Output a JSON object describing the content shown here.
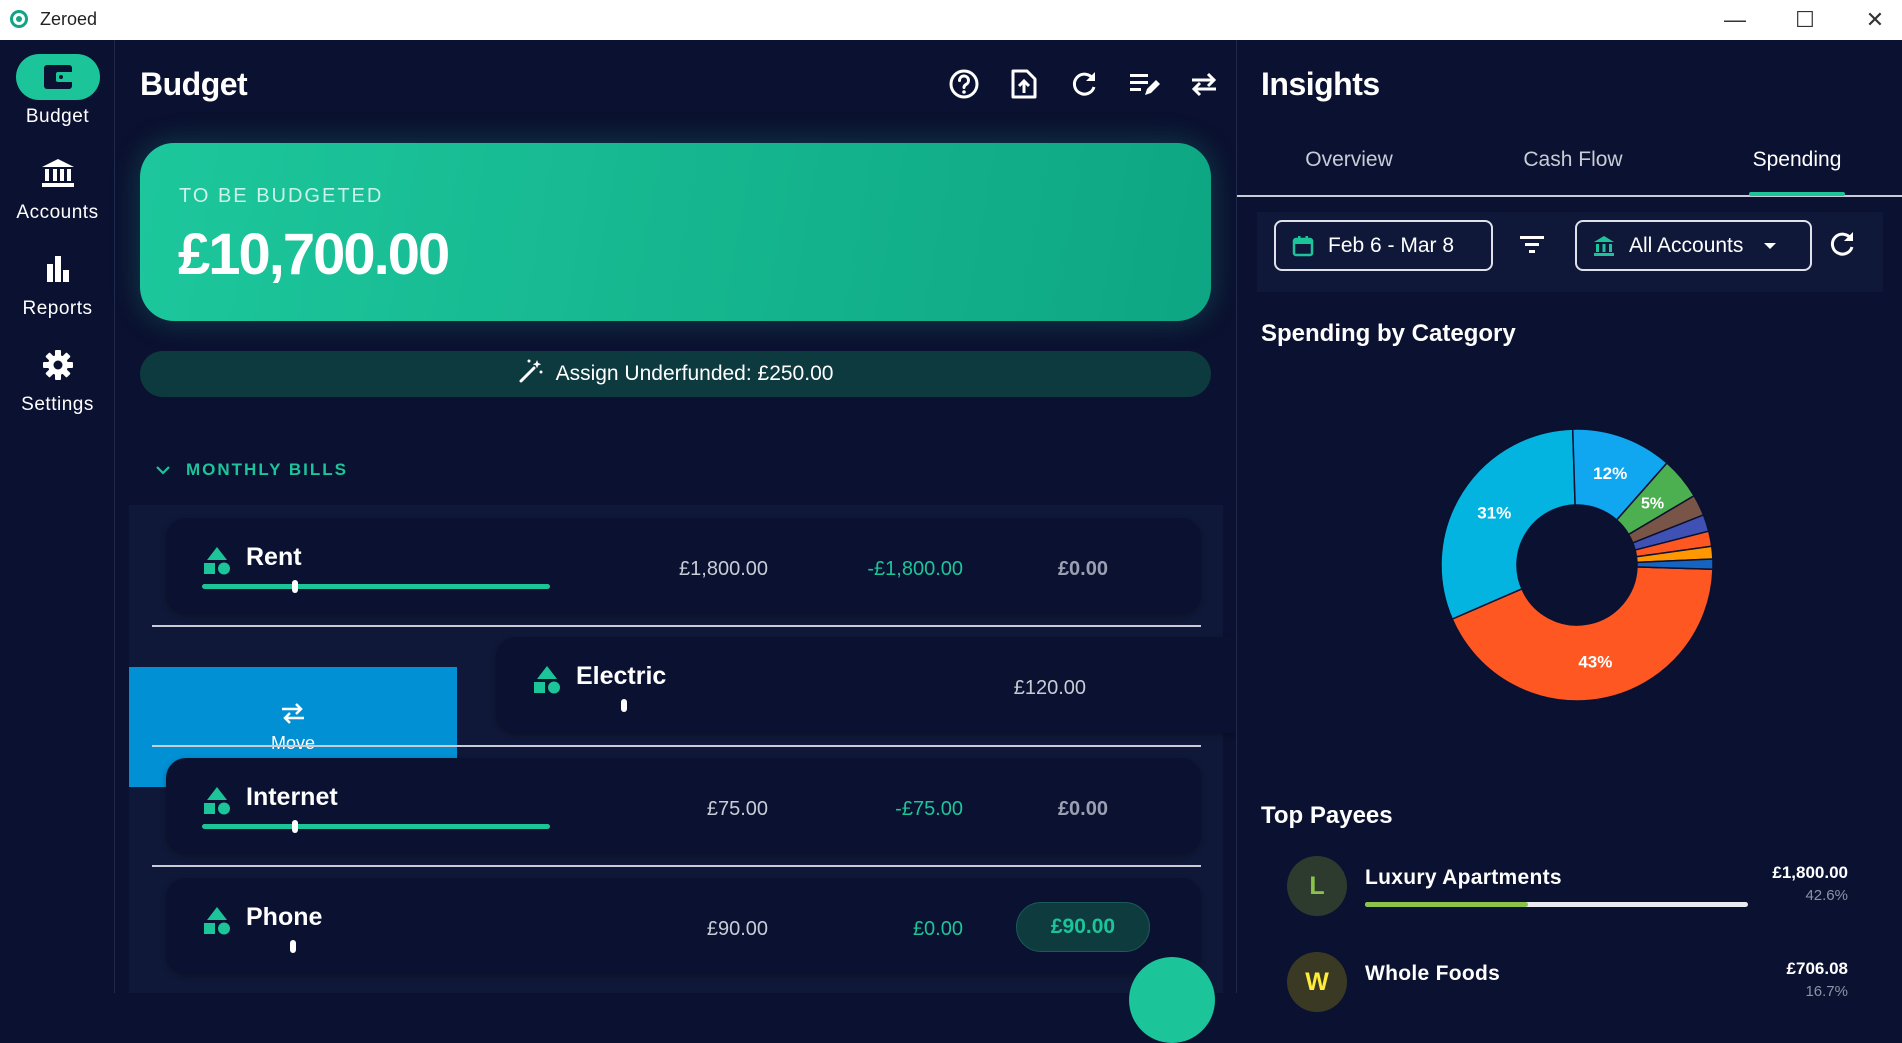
{
  "window": {
    "title": "Zeroed",
    "controls": [
      "—",
      "☐",
      "✕"
    ]
  },
  "sidebar": {
    "items": [
      {
        "label": "Budget",
        "icon": "wallet-icon",
        "active": true
      },
      {
        "label": "Accounts",
        "icon": "bank-icon",
        "active": false
      },
      {
        "label": "Reports",
        "icon": "bar-chart-icon",
        "active": false
      },
      {
        "label": "Settings",
        "icon": "gear-icon",
        "active": false
      }
    ]
  },
  "budget": {
    "title": "Budget",
    "toolbar_icons": [
      "help-icon",
      "export-icon",
      "refresh-icon",
      "edit-list-icon",
      "swap-icon"
    ],
    "to_be_budgeted": {
      "label": "TO BE BUDGETED",
      "amount": "£10,700.00"
    },
    "assign_underfunded": "Assign Underfunded: £250.00",
    "group": {
      "name": "MONTHLY BILLS"
    },
    "categories": [
      {
        "name": "Rent",
        "budgeted": "£1,800.00",
        "activity": "-£1,800.00",
        "available": "£0.00",
        "progress": 1.0
      },
      {
        "name": "Electric",
        "budgeted": "£120.00",
        "activity": "",
        "available": "",
        "progress": 0.0,
        "swiped": true
      },
      {
        "name": "Internet",
        "budgeted": "£75.00",
        "activity": "-£75.00",
        "available": "£0.00",
        "progress": 1.0
      },
      {
        "name": "Phone",
        "budgeted": "£90.00",
        "activity": "£0.00",
        "available": "£90.00",
        "progress": 0.0
      }
    ],
    "swipe_action": {
      "label": "Move",
      "icon": "swap-arrows-icon"
    }
  },
  "insights": {
    "title": "Insights",
    "tabs": [
      {
        "label": "Overview",
        "active": false
      },
      {
        "label": "Cash Flow",
        "active": false
      },
      {
        "label": "Spending",
        "active": true
      }
    ],
    "date_range": "Feb 6 - Mar 8",
    "account_filter": "All Accounts",
    "spending_title": "Spending by Category",
    "top_payees_title": "Top Payees",
    "payees": [
      {
        "initial": "L",
        "name": "Luxury Apartments",
        "amount": "£1,800.00",
        "percent": "42.6%",
        "share": 0.426,
        "avatar_bg": "#2c3b2e",
        "avatar_fg": "#8bc34a"
      },
      {
        "initial": "W",
        "name": "Whole Foods",
        "amount": "£706.08",
        "percent": "16.7%",
        "share": 0.167,
        "avatar_bg": "#3a3a24",
        "avatar_fg": "#ffeb3b"
      }
    ]
  },
  "chart_data": {
    "type": "pie",
    "donut": true,
    "title": "Spending by Category",
    "labels_shown": [
      "43%",
      "31%",
      "12%",
      "5%"
    ],
    "slices": [
      {
        "value": 43,
        "label": "43%",
        "color": "#ff5722"
      },
      {
        "value": 31,
        "label": "31%",
        "color": "#03b4e0"
      },
      {
        "value": 12,
        "label": "12%",
        "color": "#11a6f0"
      },
      {
        "value": 5,
        "label": "5%",
        "color": "#4caf50"
      },
      {
        "value": 2.5,
        "label": "",
        "color": "#795548"
      },
      {
        "value": 2,
        "label": "",
        "color": "#3f51b5"
      },
      {
        "value": 1.8,
        "label": "",
        "color": "#ff5722"
      },
      {
        "value": 1.5,
        "label": "",
        "color": "#ff9800"
      },
      {
        "value": 1.2,
        "label": "",
        "color": "#1565c0"
      }
    ]
  },
  "colors": {
    "accent": "#1cc49a",
    "background": "#0b1130",
    "move": "#0190d4"
  }
}
